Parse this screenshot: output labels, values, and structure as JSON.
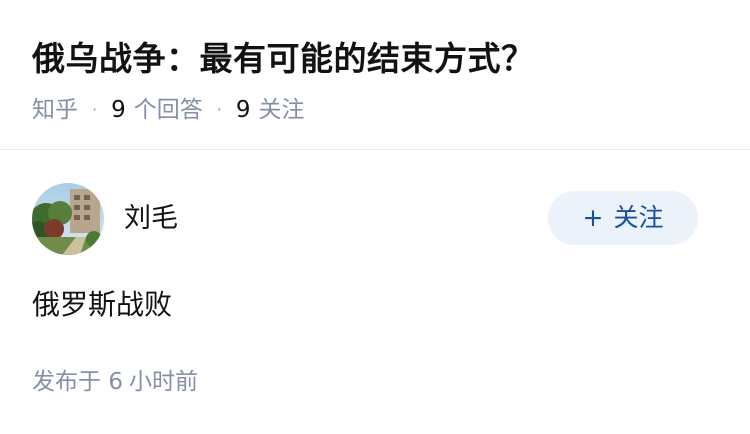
{
  "question": {
    "title": "俄乌战争：最有可能的结束方式？",
    "source": "知乎",
    "answer_count": "9",
    "answer_label": "个回答",
    "follow_count": "9",
    "follow_label": "关注"
  },
  "answer": {
    "author_name": "刘毛",
    "follow_button_icon": "+",
    "follow_button_label": "关注",
    "content": "俄罗斯战败",
    "published_prefix": "发布于",
    "published_value": "6",
    "published_suffix": "小时前"
  },
  "colors": {
    "accent": "#175199",
    "follow_bg": "#ebf2fa",
    "meta_gray": "#8590a6"
  }
}
